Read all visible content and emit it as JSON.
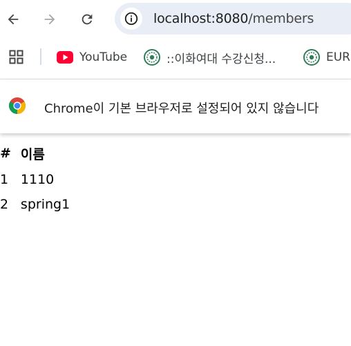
{
  "browser": {
    "url_host": "localhost:8080",
    "url_path": "/members",
    "icons": {
      "back": "arrow-left-icon",
      "forward": "arrow-right-icon",
      "reload": "reload-icon",
      "site_info": "info-icon",
      "apps": "apps-grid-icon"
    }
  },
  "bookmarks": [
    {
      "label": "YouTube",
      "icon": "youtube-icon"
    },
    {
      "label": "::이화여대 수강신청...",
      "icon": "ewha-seal-icon"
    },
    {
      "label": "EUR",
      "icon": "ewha-seal-icon"
    }
  ],
  "infobar": {
    "message": "Chrome이 기본 브라우저로 설정되어 있지 않습니다",
    "icon": "chrome-logo-icon"
  },
  "members_table": {
    "headers": [
      "#",
      "이름"
    ],
    "rows": [
      {
        "id": "1",
        "name": "1110"
      },
      {
        "id": "2",
        "name": "spring1"
      }
    ]
  },
  "colors": {
    "omnibox_bg": "#e9edf6",
    "youtube_red": "#ff0033",
    "ewha_green": "#2e7d5b"
  }
}
